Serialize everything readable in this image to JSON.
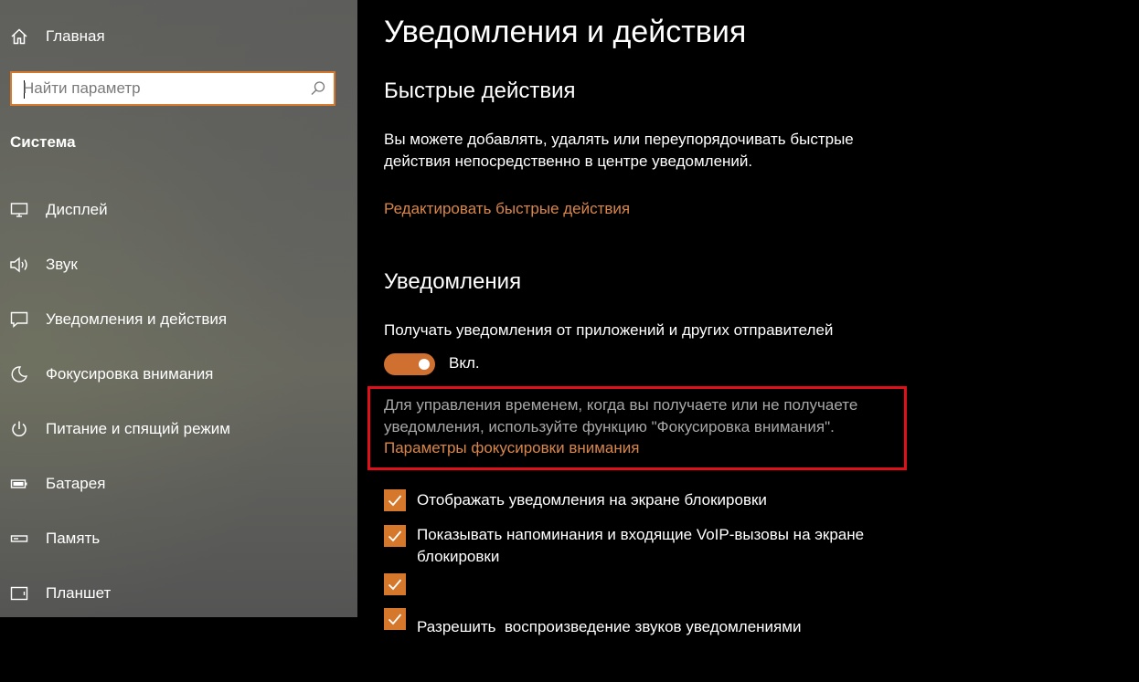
{
  "sidebar": {
    "home_label": "Главная",
    "search_placeholder": "Найти параметр",
    "section_title": "Система",
    "items": [
      {
        "label": "Дисплей",
        "icon": "display-icon"
      },
      {
        "label": "Звук",
        "icon": "speaker-icon"
      },
      {
        "label": "Уведомления и действия",
        "icon": "notification-icon"
      },
      {
        "label": "Фокусировка внимания",
        "icon": "moon-icon"
      },
      {
        "label": "Питание и спящий режим",
        "icon": "power-icon"
      },
      {
        "label": "Батарея",
        "icon": "battery-icon"
      },
      {
        "label": "Память",
        "icon": "storage-icon"
      },
      {
        "label": "Планшет",
        "icon": "tablet-icon"
      }
    ]
  },
  "main": {
    "title": "Уведомления и действия",
    "quick_actions": {
      "heading": "Быстрые действия",
      "description_line1": "Вы можете добавлять, удалять или переупорядочивать быстрые",
      "description_line2": "действия непосредственно в центре уведомлений.",
      "edit_link": "Редактировать быстрые действия"
    },
    "notifications": {
      "heading": "Уведомления",
      "get_notifications_label": "Получать уведомления от приложений и других отправителей",
      "toggle_state": "Вкл.",
      "focus_text_line1": "Для управления временем, когда вы получаете или не получаете",
      "focus_text_line2": "уведомления, используйте функцию \"Фокусировка внимания\".",
      "focus_link": "Параметры фокусировки внимания",
      "checkboxes": [
        {
          "line1": "Отображать уведомления на экране блокировки",
          "line2": ""
        },
        {
          "line1": "Показывать напоминания и входящие VoIP-вызовы на экране",
          "line2": "блокировки"
        },
        {
          "line1": "Разрешить  воспроизведение звуков уведомлениями",
          "line2": ""
        }
      ]
    }
  },
  "colors": {
    "accent": "#d6782b",
    "link": "#d9864a",
    "highlight_border": "#e0101a"
  }
}
